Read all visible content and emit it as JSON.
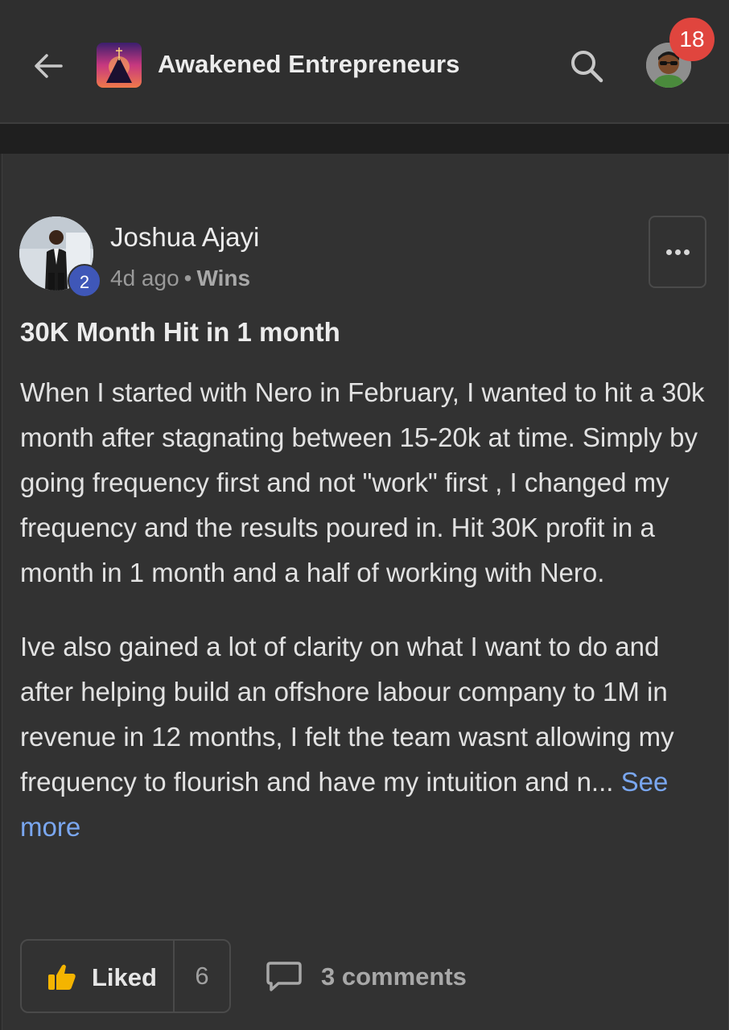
{
  "header": {
    "group_name": "Awakened Entrepreneurs",
    "notification_count": "18"
  },
  "post": {
    "author": "Joshua Ajayi",
    "author_level": "2",
    "time_ago": "4d ago",
    "separator": "•",
    "category": "Wins",
    "title": "30K Month Hit in 1 month",
    "paragraph_1": "When I started with Nero in February, I wanted to hit a 30k month after stagnating between 15-20k at time. Simply by going frequency first and not \"work\" first , I changed my frequency and the results poured in. Hit 30K profit in a month in 1 month and a half of working with Nero.",
    "paragraph_2_preview": "Ive also gained a lot of clarity on what I want to do and after helping build an offshore labour company to 1M in revenue in 12 months, I felt the team wasnt allowing my frequency to flourish and have my intuition and n...",
    "see_more_label": "See more"
  },
  "actions": {
    "like_label": "Liked",
    "like_count": "6",
    "comments_label": "3 comments"
  },
  "colors": {
    "background": "#2b2b2b",
    "card": "#323232",
    "badge_red": "#e0453e",
    "level_blue": "#3f57b8",
    "link_blue": "#7aa7f0"
  }
}
